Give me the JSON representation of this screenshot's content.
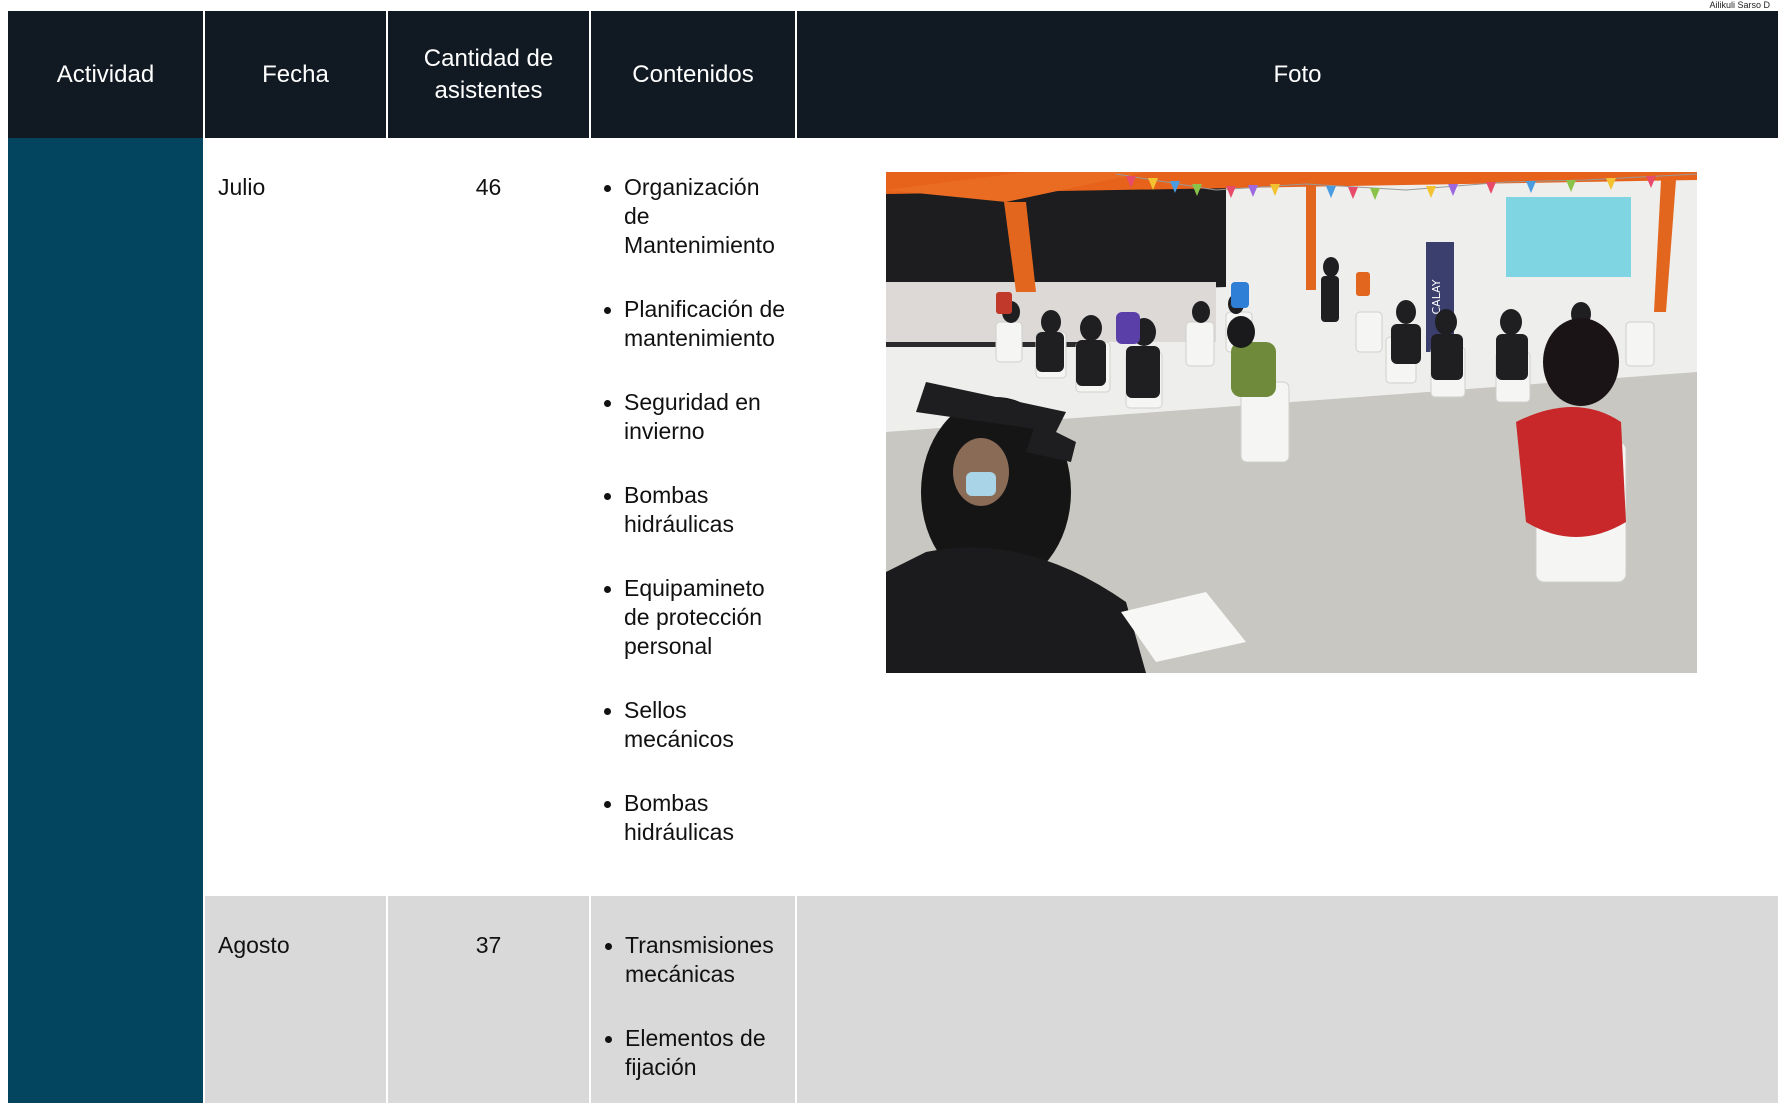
{
  "header_note": "Ailikuli Sarso D",
  "columns": {
    "actividad": "Actividad",
    "fecha": "Fecha",
    "cantidad": "Cantidad de asistentes",
    "contenidos": "Contenidos",
    "foto": "Foto"
  },
  "rows": [
    {
      "fecha": "Julio",
      "cantidad": "46",
      "contenidos": [
        "Organización de Mantenimiento",
        "Planificación de mantenimiento",
        "Seguridad en invierno",
        "Bombas hidráulicas",
        "Equipamineto de protección personal",
        "Sellos mecánicos",
        "Bombas hidráulicas"
      ],
      "photo_sign": "CALAY"
    },
    {
      "fecha": "Agosto",
      "cantidad": "37",
      "contenidos": [
        "Transmisiones mecánicas",
        "Elementos de fijación"
      ]
    }
  ],
  "colors": {
    "header_bg": "#111a22",
    "actividad_bg": "#03455f",
    "alt_row_bg": "#d9d9d9"
  }
}
